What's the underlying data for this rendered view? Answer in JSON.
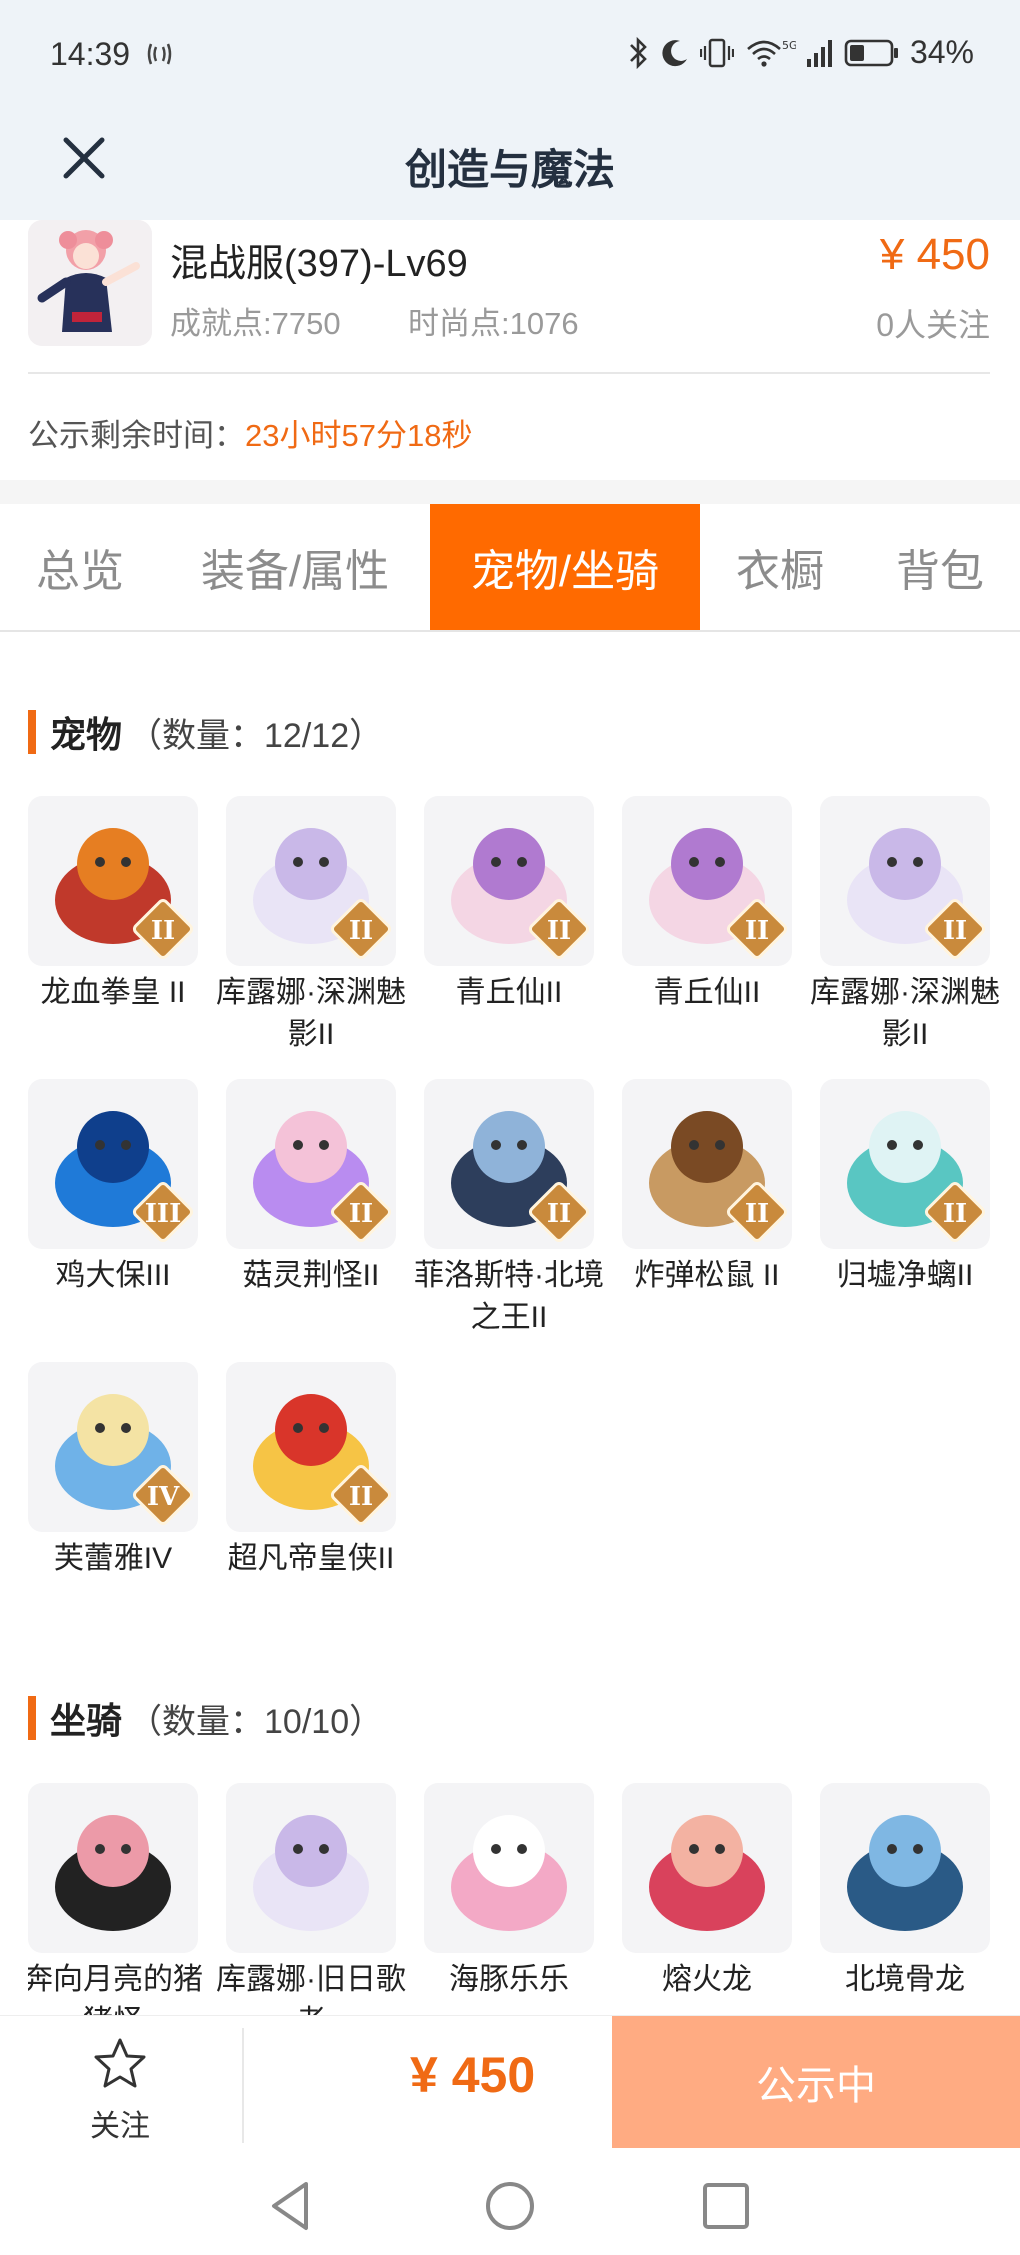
{
  "status": {
    "time": "14:39",
    "battery": "34%"
  },
  "header": {
    "title": "创造与魔法"
  },
  "role": {
    "name": "混战服(397)-Lv69",
    "achievement": "成就点:7750",
    "fashion": "时尚点:1076",
    "price": "¥ 450",
    "followers": "0人关注"
  },
  "countdown": {
    "label": "公示剩余时间：",
    "value": "23小时57分18秒"
  },
  "tabs": [
    {
      "label": "总览"
    },
    {
      "label": "装备/属性"
    },
    {
      "label": "宠物/坐骑"
    },
    {
      "label": "衣橱"
    },
    {
      "label": "背包"
    }
  ],
  "pets": {
    "title": "宠物",
    "count": "（数量：12/12）",
    "items": [
      {
        "name": "龙血拳皇 II",
        "tier": "II"
      },
      {
        "name": "库露娜·深渊魅影II",
        "tier": "II"
      },
      {
        "name": "青丘仙II",
        "tier": "II"
      },
      {
        "name": "青丘仙II",
        "tier": "II"
      },
      {
        "name": "库露娜·深渊魅影II",
        "tier": "II"
      },
      {
        "name": "鸡大保III",
        "tier": "III"
      },
      {
        "name": "菇灵荆怪II",
        "tier": "II"
      },
      {
        "name": "菲洛斯特·北境之王II",
        "tier": "II"
      },
      {
        "name": "炸弹松鼠 II",
        "tier": "II"
      },
      {
        "name": "归墟净螭II",
        "tier": "II"
      },
      {
        "name": "芙蕾雅IV",
        "tier": "IV"
      },
      {
        "name": "超凡帝皇侠II",
        "tier": "II"
      }
    ]
  },
  "mounts": {
    "title": "坐骑",
    "count": "（数量：10/10）",
    "items": [
      {
        "name": "奔向月亮的猪猪怪"
      },
      {
        "name": "库露娜·旧日歌者"
      },
      {
        "name": "海豚乐乐"
      },
      {
        "name": "熔火龙"
      },
      {
        "name": "北境骨龙"
      }
    ]
  },
  "bottom": {
    "follow_label": "关注",
    "price": "¥ 450",
    "action": "公示中"
  },
  "colors": {
    "accent": "#ff6a00",
    "price": "#f06a14",
    "action_bg": "#ffab82"
  }
}
